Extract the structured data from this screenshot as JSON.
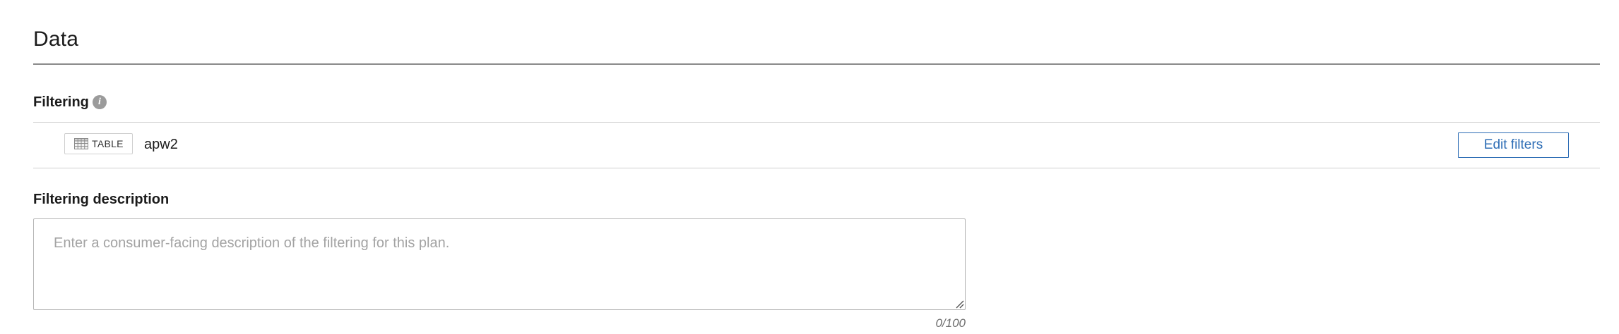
{
  "section": {
    "title": "Data"
  },
  "filtering": {
    "heading": "Filtering",
    "info_icon": "info-icon",
    "items": [
      {
        "type_icon": "table-icon",
        "type_label": "TABLE",
        "name": "apw2"
      }
    ],
    "edit_button_label": "Edit filters"
  },
  "description": {
    "heading": "Filtering description",
    "value": "",
    "placeholder": "Enter a consumer-facing description of the filtering for this plan.",
    "char_count": "0/100"
  },
  "colors": {
    "accent": "#2d6db5",
    "divider": "#cfcfcf",
    "info_icon_bg": "#9b9b9b"
  }
}
